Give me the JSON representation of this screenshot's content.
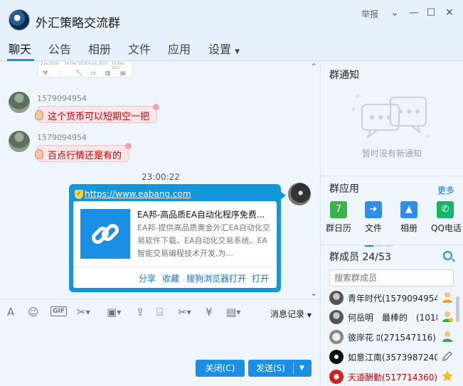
{
  "window": {
    "title": "外汇策略交流群",
    "report_label": "举报"
  },
  "tabs": [
    {
      "label": "聊天"
    },
    {
      "label": "公告"
    },
    {
      "label": "相册"
    },
    {
      "label": "文件"
    },
    {
      "label": "应用"
    },
    {
      "label": "设置"
    }
  ],
  "chat": {
    "top_card_dates": [
      "3 Jul 2016",
      "16 Dec 2016",
      "4 Jun 2017",
      "19 Nov 2017"
    ],
    "messages": [
      {
        "sender": "1579094954",
        "text": "这个货币可以短期空一把"
      },
      {
        "sender": "1579094954",
        "text": "百点行情还是有的"
      }
    ],
    "timestamp": "23:00:22",
    "link_message": {
      "url": "https://www.eabang.com",
      "title": "EA邦-高品质EA自动化程序免费...",
      "description": "EA邦-提供高品质黄金外汇EA自动化交易软件下载、EA自动化交易系统、EA智能交易编程技术开发,为...",
      "actions": [
        "分享",
        "收藏",
        "搜狗浏览器打开",
        "打开"
      ]
    }
  },
  "toolbar": {
    "gif_label": "GIF",
    "history_label": "消息记录"
  },
  "compose": {
    "close_label": "关闭(C)",
    "send_label": "发送(S)"
  },
  "sidebar": {
    "notice_title": "群通知",
    "notice_empty": "暂时没有新通知",
    "apps_title": "群应用",
    "apps_more": "更多",
    "apps": [
      {
        "label": "群日历",
        "icon": "calendar-icon",
        "color": "#3bb24a",
        "glyph": "7"
      },
      {
        "label": "文件",
        "icon": "file-upload-icon",
        "color": "#2f8ee6",
        "glyph": "➜"
      },
      {
        "label": "相册",
        "icon": "photo-album-icon",
        "color": "#2f8ee6",
        "glyph": "▲"
      },
      {
        "label": "QQ电话",
        "icon": "phone-icon",
        "color": "#15b36b",
        "glyph": "✆"
      }
    ],
    "members_title": "群成员 24/53",
    "members_search_placeholder": "搜索群成员",
    "members": [
      {
        "name": "青年时代(1579094954)",
        "badge": "owner-icon",
        "badge_color": "#f0a020"
      },
      {
        "name": "何岳明　最棒的　(1018",
        "badge": "admin-icon",
        "badge_color": "#3aa64a"
      },
      {
        "name": "彼岸花 ﾛ(271547116)",
        "badge": "admin-icon",
        "badge_color": "#3aa64a"
      },
      {
        "name": "如意江南(3573987240)",
        "badge": "edit-icon",
        "badge_color": "#777777"
      },
      {
        "name": "天道酬勤(517714360)",
        "badge": "star-icon",
        "badge_color": "#f0c020",
        "red": true
      }
    ]
  }
}
